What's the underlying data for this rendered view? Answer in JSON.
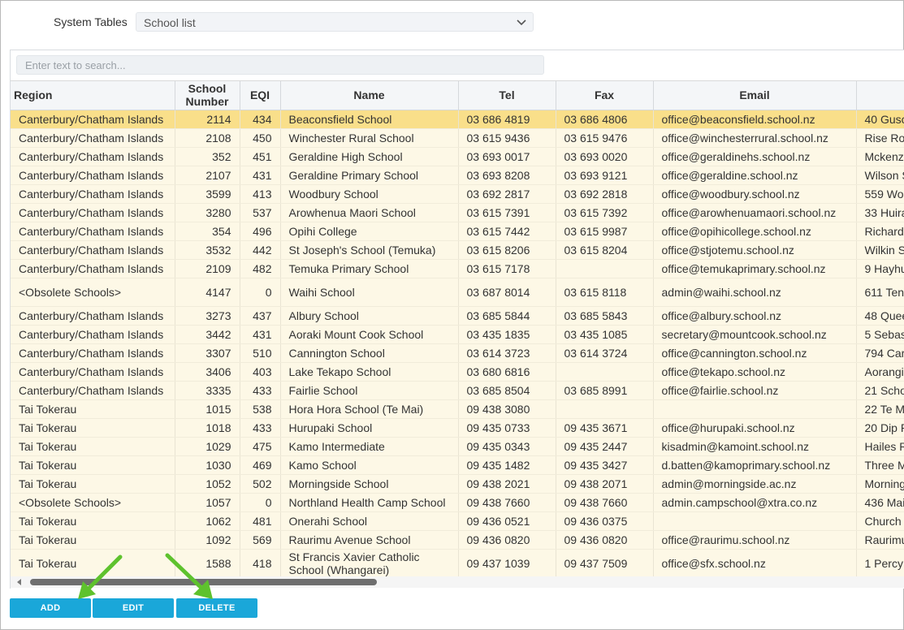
{
  "header": {
    "label": "System Tables",
    "select_value": "School list",
    "chevron_icon": "chevron-down-icon"
  },
  "search": {
    "placeholder": "Enter text to search..."
  },
  "grid": {
    "columns": [
      "Region",
      "School Number",
      "EQI",
      "Name",
      "Tel",
      "Fax",
      "Email",
      ""
    ],
    "rows": [
      [
        "Canterbury/Chatham Islands",
        "2114",
        "434",
        "Beaconsfield School",
        "03 686 4819",
        "03 686 4806",
        "office@beaconsfield.school.nz",
        "40 Gusc"
      ],
      [
        "Canterbury/Chatham Islands",
        "2108",
        "450",
        "Winchester Rural School",
        "03 615 9436",
        "03 615 9476",
        "office@winchesterrural.school.nz",
        "Rise Ro"
      ],
      [
        "Canterbury/Chatham Islands",
        "352",
        "451",
        "Geraldine High School",
        "03 693 0017",
        "03 693 0020",
        "office@geraldinehs.school.nz",
        "Mckenz"
      ],
      [
        "Canterbury/Chatham Islands",
        "2107",
        "431",
        "Geraldine Primary School",
        "03 693 8208",
        "03 693 9121",
        "office@geraldine.school.nz",
        "Wilson S"
      ],
      [
        "Canterbury/Chatham Islands",
        "3599",
        "413",
        "Woodbury School",
        "03 692 2817",
        "03 692 2818",
        "office@woodbury.school.nz",
        "559 Wo"
      ],
      [
        "Canterbury/Chatham Islands",
        "3280",
        "537",
        "Arowhenua Maori School",
        "03 615 7391",
        "03 615 7392",
        "office@arowhenuamaori.school.nz",
        "33 Huira"
      ],
      [
        "Canterbury/Chatham Islands",
        "354",
        "496",
        "Opihi College",
        "03 615 7442",
        "03 615 9987",
        "office@opihicollege.school.nz",
        "Richard"
      ],
      [
        "Canterbury/Chatham Islands",
        "3532",
        "442",
        "St Joseph's School (Temuka)",
        "03 615 8206",
        "03 615 8204",
        "office@stjotemu.school.nz",
        "Wilkin S"
      ],
      [
        "Canterbury/Chatham Islands",
        "2109",
        "482",
        "Temuka Primary School",
        "03 615 7178",
        "",
        "office@temukaprimary.school.nz",
        "9 Hayhu"
      ],
      [
        "<Obsolete Schools>",
        "4147",
        "0",
        "Waihi School",
        "03 687 8014",
        "03 615 8118",
        "admin@waihi.school.nz",
        "611 Ten"
      ],
      [
        "Canterbury/Chatham Islands",
        "3273",
        "437",
        "Albury School",
        "03 685 5844",
        "03 685 5843",
        "office@albury.school.nz",
        "48 Quee"
      ],
      [
        "Canterbury/Chatham Islands",
        "3442",
        "431",
        "Aoraki Mount Cook School",
        "03 435 1835",
        "03 435 1085",
        "secretary@mountcook.school.nz",
        "5 Sebas"
      ],
      [
        "Canterbury/Chatham Islands",
        "3307",
        "510",
        "Cannington School",
        "03 614 3723",
        "03 614 3724",
        "office@cannington.school.nz",
        "794 Car"
      ],
      [
        "Canterbury/Chatham Islands",
        "3406",
        "403",
        "Lake Tekapo School",
        "03 680 6816",
        "",
        "office@tekapo.school.nz",
        "Aorangi"
      ],
      [
        "Canterbury/Chatham Islands",
        "3335",
        "433",
        "Fairlie School",
        "03 685 8504",
        "03 685 8991",
        "office@fairlie.school.nz",
        "21 Scho"
      ],
      [
        "Tai Tokerau",
        "1015",
        "538",
        "Hora Hora School (Te Mai)",
        "09 438 3080",
        "",
        "",
        "22 Te M"
      ],
      [
        "Tai Tokerau",
        "1018",
        "433",
        "Hurupaki School",
        "09 435 0733",
        "09 435 3671",
        "office@hurupaki.school.nz",
        "20 Dip R"
      ],
      [
        "Tai Tokerau",
        "1029",
        "475",
        "Kamo Intermediate",
        "09 435 0343",
        "09 435 2447",
        "kisadmin@kamoint.school.nz",
        "Hailes R"
      ],
      [
        "Tai Tokerau",
        "1030",
        "469",
        "Kamo School",
        "09 435 1482",
        "09 435 3427",
        "d.batten@kamoprimary.school.nz",
        "Three M"
      ],
      [
        "Tai Tokerau",
        "1052",
        "502",
        "Morningside School",
        "09 438 2021",
        "09 438 2071",
        "admin@morningside.ac.nz",
        "Mornings"
      ],
      [
        "<Obsolete Schools>",
        "1057",
        "0",
        "Northland Health Camp School",
        "09 438 7660",
        "09 438 7660",
        "admin.campschool@xtra.co.nz",
        "436 Mai"
      ],
      [
        "Tai Tokerau",
        "1062",
        "481",
        "Onerahi School",
        "09 436 0521",
        "09 436 0375",
        "",
        "Church S"
      ],
      [
        "Tai Tokerau",
        "1092",
        "569",
        "Raurimu Avenue School",
        "09 436 0820",
        "09 436 0820",
        "office@raurimu.school.nz",
        "Raurimu"
      ],
      [
        "Tai Tokerau",
        "1588",
        "418",
        "St Francis Xavier Catholic School (Whangarei)",
        "09 437 1039",
        "09 437 7509",
        "office@sfx.school.nz",
        "1 Percy"
      ]
    ]
  },
  "buttons": {
    "add": "ADD",
    "edit": "EDIT",
    "delete": "DELETE"
  },
  "colors": {
    "accent": "#1aa7d9",
    "selected_row": "#f9df8a",
    "row_bg": "#fdf8e6",
    "arrow": "#5ec22d"
  }
}
